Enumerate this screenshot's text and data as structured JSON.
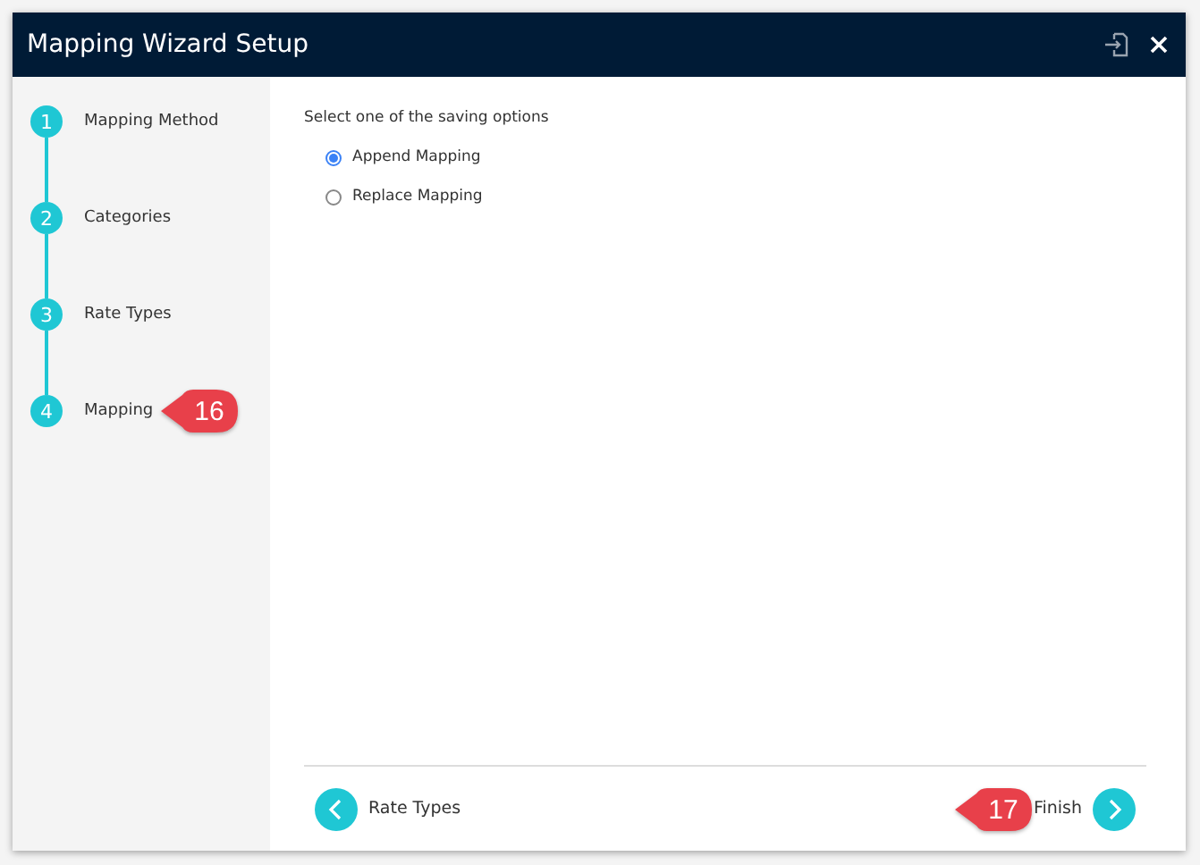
{
  "window": {
    "title": "Mapping Wizard Setup"
  },
  "steps": [
    {
      "number": "1",
      "label": "Mapping Method"
    },
    {
      "number": "2",
      "label": "Categories"
    },
    {
      "number": "3",
      "label": "Rate Types"
    },
    {
      "number": "4",
      "label": "Mapping",
      "callout": "16"
    }
  ],
  "prompt": "Select one of the saving options",
  "options": [
    {
      "label": "Append Mapping",
      "selected": true
    },
    {
      "label": "Replace Mapping",
      "selected": false
    }
  ],
  "footer": {
    "back": "Rate Types",
    "next": "Finish",
    "next_callout": "17"
  }
}
